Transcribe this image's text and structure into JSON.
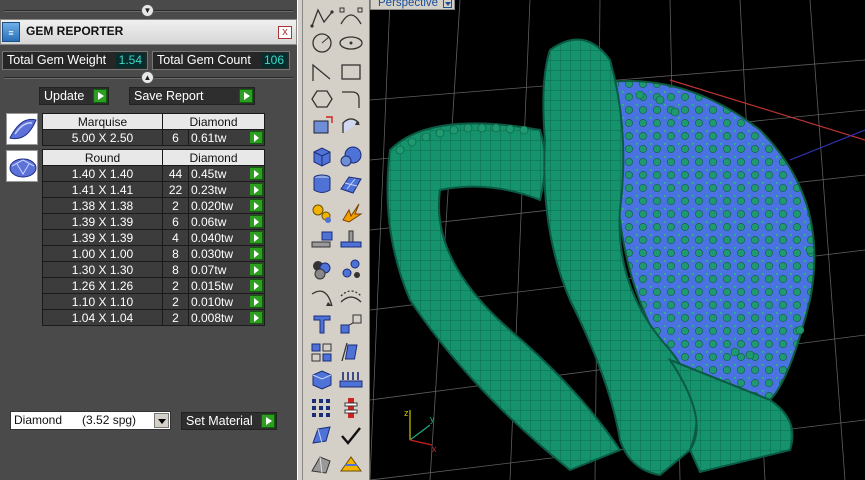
{
  "panel": {
    "title": "GEM REPORTER",
    "close_label": "x",
    "total_weight_label": "Total Gem Weight",
    "total_weight_value": "1.54",
    "total_count_label": "Total Gem Count",
    "total_count_value": "106",
    "update_label": "Update",
    "save_report_label": "Save Report",
    "set_material_label": "Set Material",
    "material_value": "Diamond      (3.52 spg)"
  },
  "groups": [
    {
      "cut": "Marquise",
      "material": "Diamond",
      "rows": [
        {
          "size": "5.00 X 2.50",
          "count": "6",
          "weight": "0.61tw"
        }
      ]
    },
    {
      "cut": "Round",
      "material": "Diamond",
      "rows": [
        {
          "size": "1.40 X 1.40",
          "count": "44",
          "weight": "0.45tw"
        },
        {
          "size": "1.41 X 1.41",
          "count": "22",
          "weight": "0.23tw"
        },
        {
          "size": "1.38 X 1.38",
          "count": "2",
          "weight": "0.020tw"
        },
        {
          "size": "1.39 X 1.39",
          "count": "6",
          "weight": "0.06tw"
        },
        {
          "size": "1.39 X 1.39",
          "count": "4",
          "weight": "0.040tw"
        },
        {
          "size": "1.00 X 1.00",
          "count": "8",
          "weight": "0.030tw"
        },
        {
          "size": "1.30 X 1.30",
          "count": "8",
          "weight": "0.07tw"
        },
        {
          "size": "1.26 X 1.26",
          "count": "2",
          "weight": "0.015tw"
        },
        {
          "size": "1.10 X 1.10",
          "count": "2",
          "weight": "0.010tw"
        },
        {
          "size": "1.04 X 1.04",
          "count": "2",
          "weight": "0.008tw"
        }
      ]
    }
  ],
  "viewport": {
    "tab_label": "Perspective"
  },
  "colors": {
    "ring_green": "#17a37a",
    "gem_blue": "#5078e6",
    "accent_play": "#2e9e22",
    "stat_value": "#3ed8c8"
  },
  "toolbar_icons": [
    "polyline-icon",
    "curve-points-icon",
    "circle-icon",
    "ellipse-icon",
    "arc-icon",
    "rectangle-icon",
    "polygon-icon",
    "fillet-icon",
    "transform-icon",
    "revolve-icon",
    "box-icon",
    "sphere-icon",
    "cylinder-icon",
    "surface-icon",
    "gem-tool-icon",
    "explode-icon",
    "align-icon",
    "boolean-icon",
    "gem-cluster-icon",
    "gem-place-icon",
    "curve-edit-icon",
    "offset-curve-icon",
    "text-icon",
    "scale-icon",
    "array-icon",
    "deform-icon",
    "solid-box-icon",
    "prongs-icon",
    "grid-array-icon",
    "ring-profile-icon",
    "cutter-icon",
    "check-icon",
    "render-icon",
    "material-icon"
  ]
}
